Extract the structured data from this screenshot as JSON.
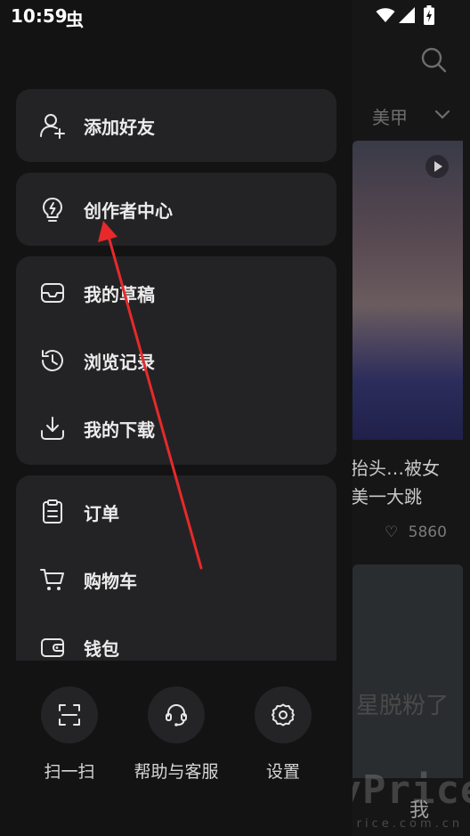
{
  "status_bar": {
    "time": "10:59",
    "app_icon_char": "虫"
  },
  "background": {
    "tab_label": "美甲",
    "card1_title_line1": "抬头…被女",
    "card1_title_line2": "美一大跳",
    "like_count": "5860",
    "card2_text": "星脱粉了",
    "bottom_tab_me": "我",
    "watermark": "MyPrice",
    "watermark_sub": "myprice.com.cn"
  },
  "drawer": {
    "add_friend": {
      "label": "添加好友",
      "icon": "add-user-icon"
    },
    "creator_center": {
      "label": "创作者中心",
      "icon": "lightbulb-icon"
    },
    "group1": [
      {
        "label": "我的草稿",
        "icon": "drafts-icon"
      },
      {
        "label": "浏览记录",
        "icon": "history-icon"
      },
      {
        "label": "我的下载",
        "icon": "download-icon"
      }
    ],
    "group2": [
      {
        "label": "订单",
        "icon": "order-icon"
      },
      {
        "label": "购物车",
        "icon": "cart-icon"
      },
      {
        "label": "钱包",
        "icon": "wallet-icon"
      }
    ],
    "bottom": [
      {
        "label": "扫一扫",
        "icon": "scan-icon"
      },
      {
        "label": "帮助与客服",
        "icon": "headset-icon"
      },
      {
        "label": "设置",
        "icon": "gear-icon"
      }
    ]
  },
  "colors": {
    "annotation_arrow": "#e8292a",
    "card_bg": "#232325",
    "drawer_bg": "#131314"
  }
}
